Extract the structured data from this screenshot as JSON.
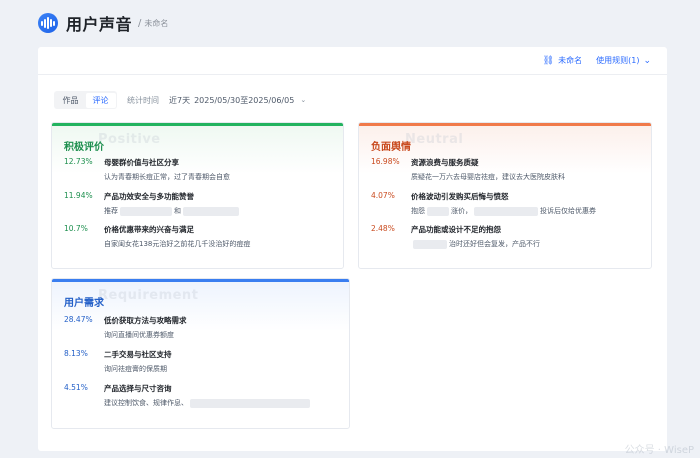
{
  "header": {
    "title": "用户声音",
    "separator": "/",
    "breadcrumb": "未命名"
  },
  "top_actions": {
    "rename_label": "未命名",
    "rules_label": "使用规则(1)"
  },
  "toolbar": {
    "tabs": [
      {
        "label": "作品",
        "active": false
      },
      {
        "label": "评论",
        "active": true
      }
    ],
    "stat_label": "统计时间",
    "range_label": "近7天",
    "date_range": "2025/05/30至2025/06/05"
  },
  "positive": {
    "title": "积极评价",
    "watermark": "Positive",
    "items": [
      {
        "pct": "12.73%",
        "title": "母婴群价值与社区分享",
        "desc": "认为青春期长痘正常，过了青春期会自愈"
      },
      {
        "pct": "11.94%",
        "title": "产品功效安全与多功能赞誉",
        "desc_a": "推荐",
        "desc_b": "和"
      },
      {
        "pct": "10.7%",
        "title": "价格优惠带来的兴奋与满足",
        "desc": "自家闺女花138元治好之前花几千没治好的痘痘"
      }
    ]
  },
  "negative": {
    "title": "负面舆情",
    "watermark": "Neutral",
    "items": [
      {
        "pct": "16.98%",
        "title": "资源浪费与服务质疑",
        "desc": "质疑花一万六去母婴店祛痘，建议去大医院皮肤科"
      },
      {
        "pct": "4.07%",
        "title": "价格波动引发购买后悔与愤怒",
        "desc_a": "抱怨",
        "desc_b": "涨价，",
        "desc_c": "投诉后仅给优惠券"
      },
      {
        "pct": "2.48%",
        "title": "产品功能或设计不足的抱怨",
        "desc": "治时还好但会复发，产品不行"
      }
    ]
  },
  "needs": {
    "title": "用户需求",
    "watermark": "Requirement",
    "items": [
      {
        "pct": "28.47%",
        "title": "低价获取方法与攻略需求",
        "desc": "询问直播间优惠券额度"
      },
      {
        "pct": "8.13%",
        "title": "二手交易与社区支持",
        "desc": "询问祛痘膏的保质期"
      },
      {
        "pct": "4.51%",
        "title": "产品选择与尺寸咨询",
        "desc": "建议控制饮食、规律作息、"
      }
    ]
  },
  "watermark_corner": "公众号 · WiseP"
}
